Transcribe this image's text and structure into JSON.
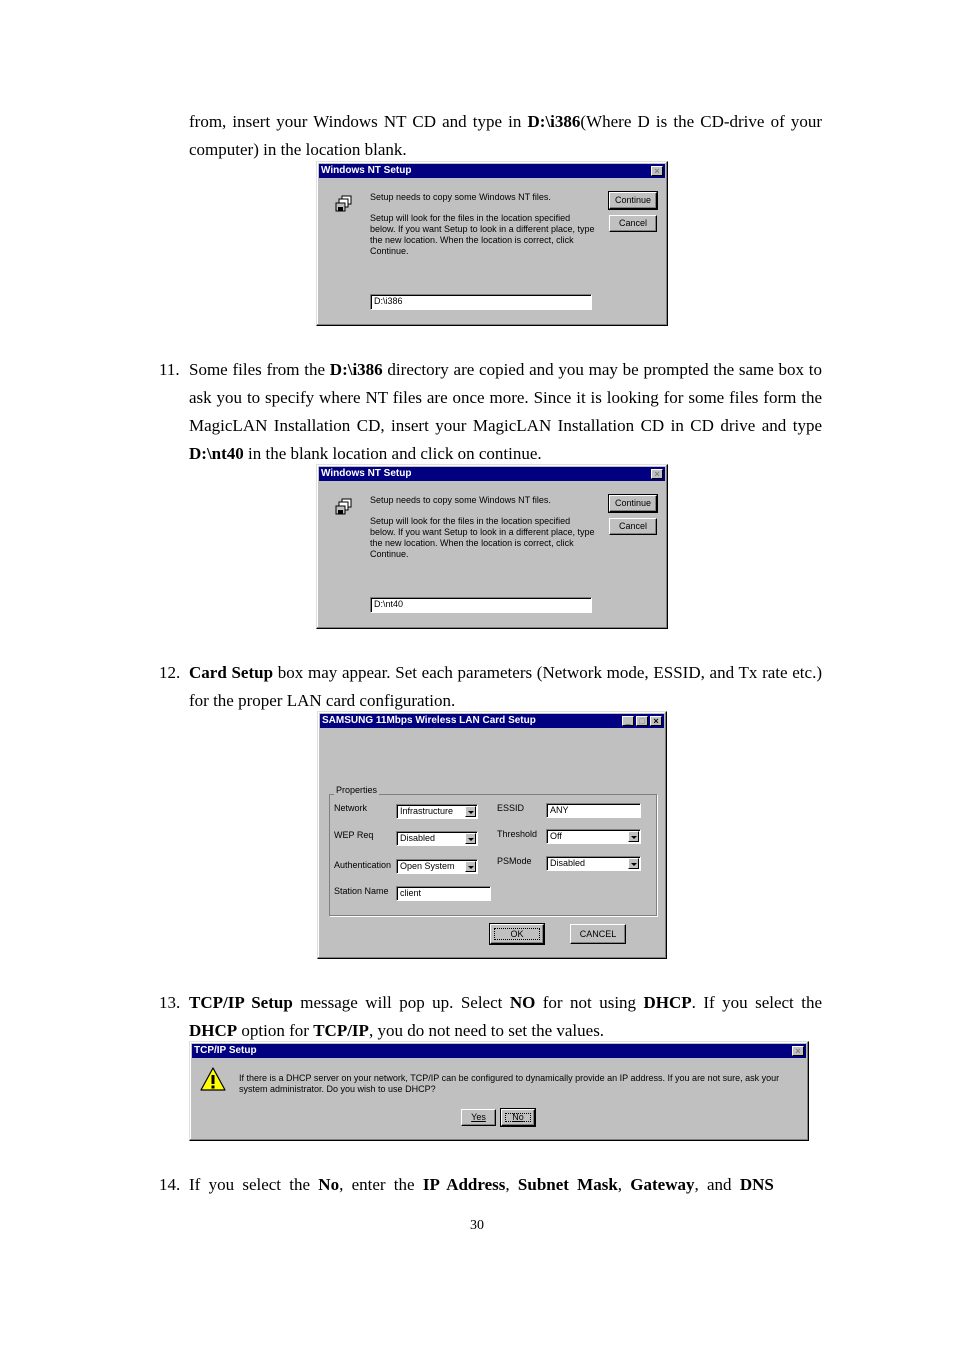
{
  "document": {
    "page_number": "30",
    "intro": {
      "t1": "from, insert your Windows NT CD and type in ",
      "b1": "D:\\i386",
      "t2": "(Where D is the CD-drive of your computer) in the location blank."
    },
    "step11": {
      "num": "11.",
      "t1": "Some files from the ",
      "b1": "D:\\i386",
      "t2": " directory are copied and you may be prompted the same box to ask you to specify where NT files are once more. Since it is looking for some files form the MagicLAN Installation CD, insert your MagicLAN Installation CD in CD drive and type ",
      "b2": "D:\\nt40",
      "t3": " in the blank location and click on continue."
    },
    "step12": {
      "num": "12.",
      "b1": "Card Setup",
      "t1": " box may appear. Set each parameters (Network mode, ESSID, and Tx rate etc.) for the proper LAN card configuration."
    },
    "step13": {
      "num": "13.",
      "b1": "TCP/IP Setup",
      "t1": " message will pop up. Select ",
      "b2": "NO",
      "t2": " for not using ",
      "b3": "DHCP",
      "t3": ". If you select the ",
      "b4": "DHCP",
      "t4": " option for ",
      "b5": "TCP/IP",
      "t5": ", you do not need to set the values."
    },
    "step14": {
      "num": "14.",
      "t1": "If you select the ",
      "b1": "No",
      "t2": ", enter the ",
      "b2": "IP Address",
      "t3": ", ",
      "b3": "Subnet Mask",
      "t4": ", ",
      "b4": "Gateway",
      "t5": ", and ",
      "b5": "DNS"
    }
  },
  "dialog_nt1": {
    "title": "Windows NT Setup",
    "icon": "floppy-disks-icon",
    "msg1": "Setup needs to copy some Windows NT files.",
    "msg2": "Setup will look for the files in the location specified below. If you want Setup to look in a different place, type the new location. When the location is correct, click Continue.",
    "location_value": "D:\\i386",
    "continue_label": "Continue",
    "cancel_label": "Cancel"
  },
  "dialog_nt2": {
    "title": "Windows NT Setup",
    "icon": "floppy-disks-icon",
    "msg1": "Setup needs to copy some Windows NT files.",
    "msg2": "Setup will look for the files in the location specified below. If you want Setup to look in a different place, type the new location. When the location is correct, click Continue.",
    "location_value": "D:\\nt40",
    "continue_label": "Continue",
    "cancel_label": "Cancel"
  },
  "dialog_card": {
    "title": "SAMSUNG 11Mbps Wireless LAN Card Setup",
    "group_label": "Properties",
    "network_label": "Network",
    "network_value": "Infrastructure",
    "wep_label": "WEP Req",
    "wep_value": "Disabled",
    "auth_label": "Authentication",
    "auth_value": "Open System",
    "station_label": "Station Name",
    "station_value": "client",
    "essid_label": "ESSID",
    "essid_value": "ANY",
    "threshold_label": "Threshold",
    "threshold_value": "Off",
    "psmode_label": "PSMode",
    "psmode_value": "Disabled",
    "ok_label": "OK",
    "cancel_label": "CANCEL"
  },
  "dialog_tcp": {
    "title": "TCP/IP Setup",
    "icon": "warning-icon",
    "message": "If there is a DHCP server on your network, TCP/IP can be configured to dynamically provide an IP address.  If you are not sure, ask your system administrator.  Do you wish to use DHCP?",
    "yes_label": "Yes",
    "no_label": "No"
  },
  "colors": {
    "titlebar": "#000080",
    "dialog_face": "#c0c0c0",
    "warning_yellow": "#ffff00"
  }
}
